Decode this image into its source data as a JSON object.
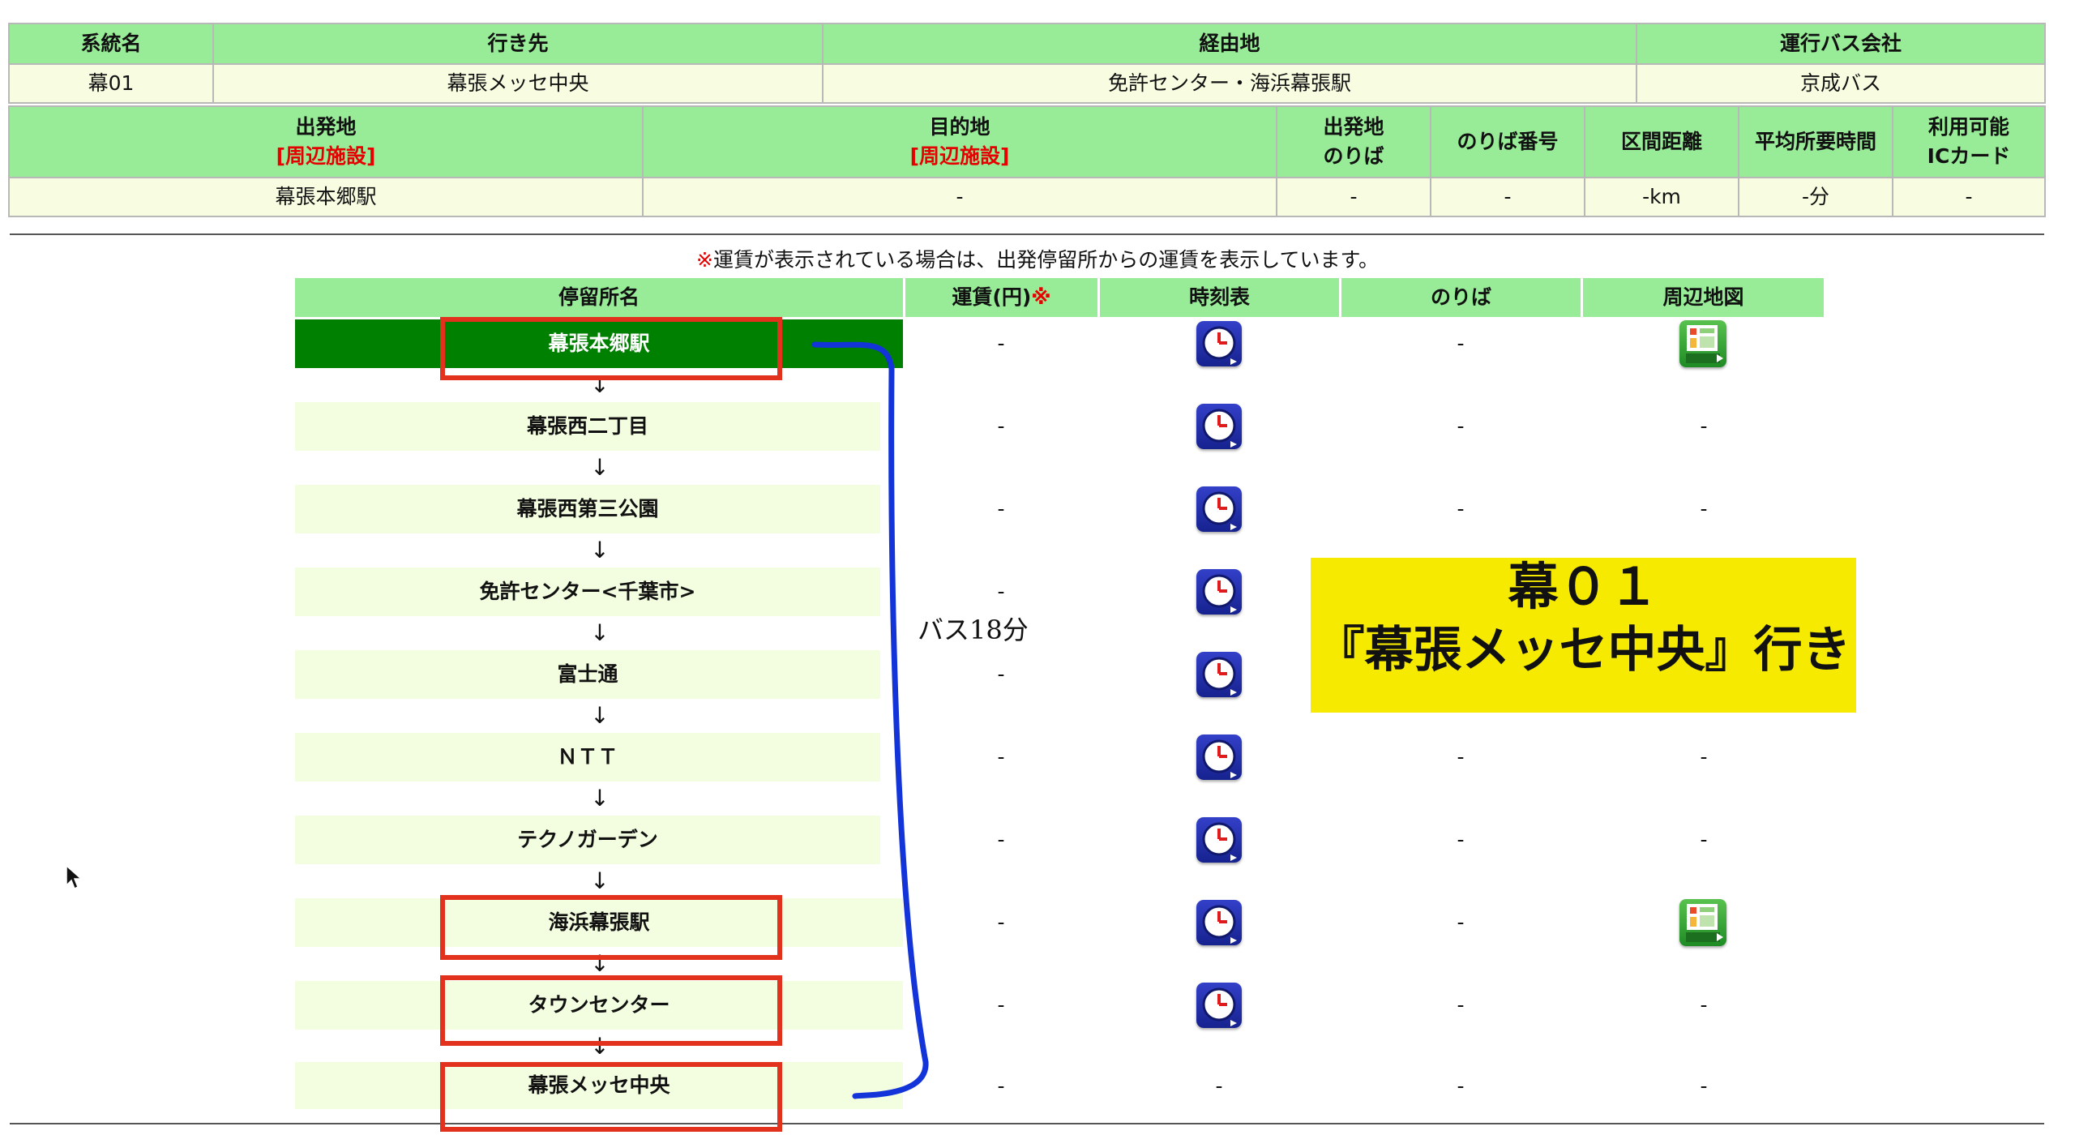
{
  "route_info": {
    "headers": [
      "系統名",
      "行き先",
      "経由地",
      "運行バス会社"
    ],
    "values": [
      "幕01",
      "幕張メッセ中央",
      "免許センター・海浜幕張駅",
      "京成バス"
    ]
  },
  "trip_info": {
    "departure_label": "出発地",
    "departure_link": "[周辺施設]",
    "destination_label": "目的地",
    "destination_link": "[周辺施設]",
    "platform_label_1": "出発地",
    "platform_label_2": "のりば",
    "platform_no": "のりば番号",
    "distance": "区間距離",
    "avg_time": "平均所要時間",
    "ic_label_1": "利用可能",
    "ic_label_2": "ICカード",
    "values": {
      "departure": "幕張本郷駅",
      "destination": "-",
      "platform": "-",
      "platform_no": "-",
      "distance": "-km",
      "avg_time": "-分",
      "ic": "-"
    }
  },
  "notice": {
    "mark": "※",
    "text": "運賃が表示されている場合は、出発停留所からの運賃を表示しています。"
  },
  "stops_header": {
    "name": "停留所名",
    "fare": "運賃(円)",
    "fare_mark": "※",
    "timetable": "時刻表",
    "platform": "のりば",
    "map": "周辺地図"
  },
  "arrow": "↓",
  "stops": [
    {
      "name": "幕張本郷駅",
      "fare": "-",
      "platform": "-",
      "map": "MAP"
    },
    {
      "name": "幕張西二丁目",
      "fare": "-",
      "platform": "-",
      "map": "-"
    },
    {
      "name": "幕張西第三公園",
      "fare": "-",
      "platform": "-",
      "map": "-"
    },
    {
      "name": "免許センター<千葉市>",
      "fare": "-",
      "platform": "",
      "map": ""
    },
    {
      "name": "富士通",
      "fare": "-",
      "platform": "",
      "map": ""
    },
    {
      "name": "ＮＴＴ",
      "fare": "-",
      "platform": "-",
      "map": "-"
    },
    {
      "name": "テクノガーデン",
      "fare": "-",
      "platform": "-",
      "map": "-"
    },
    {
      "name": "海浜幕張駅",
      "fare": "-",
      "platform": "-",
      "map": "MAP"
    },
    {
      "name": "タウンセンター",
      "fare": "-",
      "platform": "-",
      "map": "-"
    },
    {
      "name": "幕張メッセ中央",
      "fare": "-",
      "timetable": "-",
      "platform": "-",
      "map": "-"
    }
  ],
  "annotation": {
    "bus_time": "バス18分",
    "overlay_line1": "幕０１",
    "overlay_line2": "『幕張メッセ中央』行き"
  },
  "colors": {
    "header_green": "#98ec98",
    "cell_cream": "#f8fde2",
    "selected_green": "#008000",
    "highlight_red": "#e2321d",
    "bracket_blue": "#1234d8",
    "overlay_yellow": "#f5ea00"
  },
  "icons": {
    "timetable": "clock-icon",
    "map": "map-icon",
    "cursor": "mouse-pointer-icon"
  }
}
